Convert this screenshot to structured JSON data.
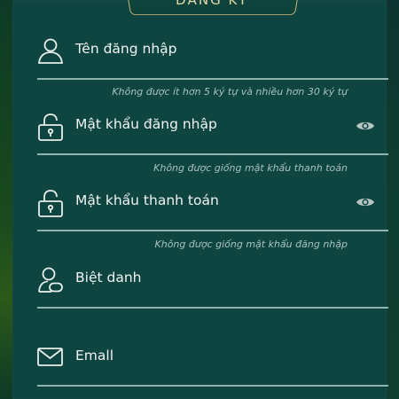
{
  "header": {
    "title": "ĐĂNG KÝ"
  },
  "fields": [
    {
      "label": "Tên đăng nhập",
      "icon": "user-icon",
      "hint": "Không được ít hơn 5 ký tự và nhiều hơn 30 ký tự"
    },
    {
      "label": "Mật khẩu đăng nhập",
      "icon": "lock-icon",
      "eye_icon": "eye-icon",
      "hint": "Không được giống mật khẩu thanh toán"
    },
    {
      "label": "Mật khẩu thanh toán",
      "icon": "lock-icon",
      "eye_icon": "eye-icon",
      "hint": "Không được giống mật khẩu đăng nhập"
    },
    {
      "label": "Biệt danh",
      "icon": "user-edit-icon"
    },
    {
      "label": "Emall",
      "icon": "mail-icon"
    }
  ],
  "colors": {
    "panel": "#0f4541",
    "text": "#f1f3f2",
    "hint": "#a8c2be",
    "line": "#8fb3ad",
    "icon": "#e9eeea",
    "gold": "#c9b47a"
  }
}
